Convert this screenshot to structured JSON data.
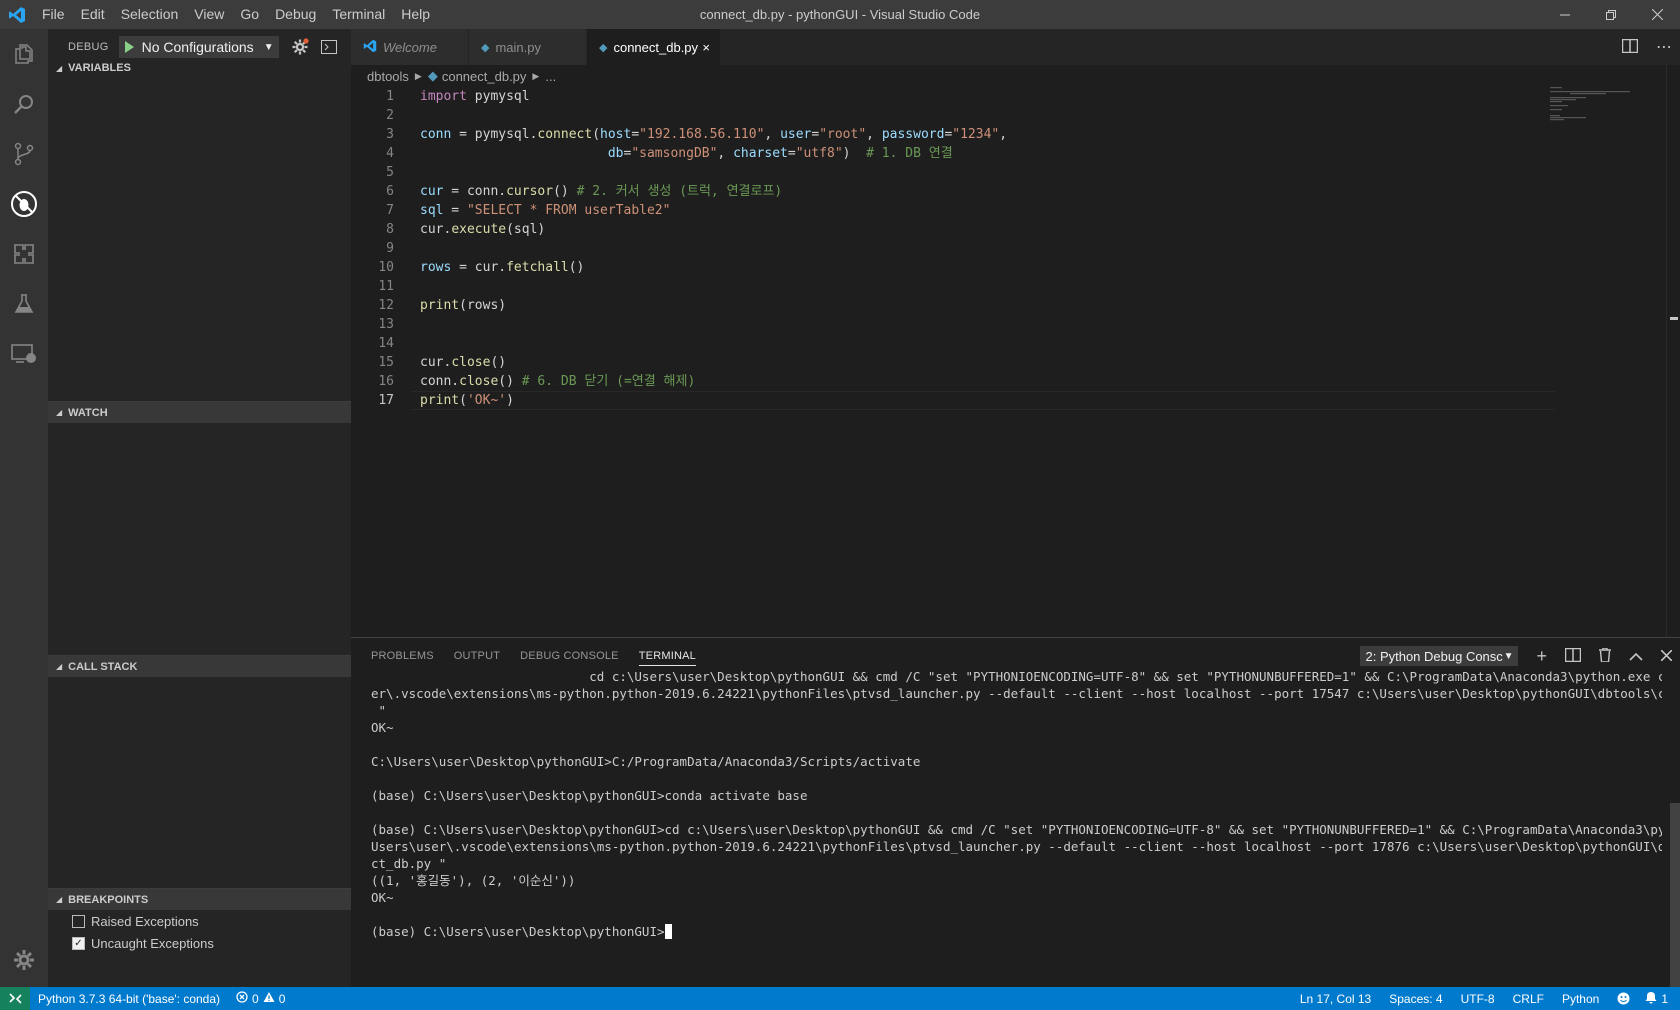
{
  "window": {
    "title": "connect_db.py - pythonGUI - Visual Studio Code",
    "menu": [
      "File",
      "Edit",
      "Selection",
      "View",
      "Go",
      "Debug",
      "Terminal",
      "Help"
    ]
  },
  "colors": {
    "accent": "#007acc",
    "remote": "#16825d",
    "run": "#89d185"
  },
  "activity_icons": [
    "files-icon",
    "search-icon",
    "source-control-icon",
    "debug-icon",
    "extensions-icon",
    "test-flask-icon",
    "remote-explorer-icon"
  ],
  "debug": {
    "label": "DEBUG",
    "configuration": "No Configurations",
    "sections": {
      "variables": "VARIABLES",
      "watch": "WATCH",
      "call_stack": "CALL STACK",
      "breakpoints": "BREAKPOINTS"
    },
    "breakpoints": [
      {
        "label": "Raised Exceptions",
        "checked": false
      },
      {
        "label": "Uncaught Exceptions",
        "checked": true
      }
    ]
  },
  "tabs": [
    {
      "label": "Welcome",
      "icon": "vscode-icon",
      "active": false
    },
    {
      "label": "main.py",
      "icon": "python-icon",
      "active": false
    },
    {
      "label": "connect_db.py",
      "icon": "python-icon",
      "active": true,
      "close": "×"
    }
  ],
  "breadcrumb": {
    "folder": "dbtools",
    "file": "connect_db.py",
    "rest": "..."
  },
  "editor": {
    "current_line": 17,
    "lines": [
      [
        {
          "t": "kw",
          "v": "import"
        },
        {
          "t": "pl",
          "v": " pymysql"
        }
      ],
      [],
      [
        {
          "t": "var",
          "v": "conn"
        },
        {
          "t": "pl",
          "v": " = pymysql."
        },
        {
          "t": "fn",
          "v": "connect"
        },
        {
          "t": "pl",
          "v": "("
        },
        {
          "t": "var",
          "v": "host"
        },
        {
          "t": "pl",
          "v": "="
        },
        {
          "t": "str",
          "v": "\"192.168.56.110\""
        },
        {
          "t": "pl",
          "v": ", "
        },
        {
          "t": "var",
          "v": "user"
        },
        {
          "t": "pl",
          "v": "="
        },
        {
          "t": "str",
          "v": "\"root\""
        },
        {
          "t": "pl",
          "v": ", "
        },
        {
          "t": "var",
          "v": "password"
        },
        {
          "t": "pl",
          "v": "="
        },
        {
          "t": "str",
          "v": "\"1234\""
        },
        {
          "t": "pl",
          "v": ","
        }
      ],
      [
        {
          "t": "pl",
          "v": "                        "
        },
        {
          "t": "var",
          "v": "db"
        },
        {
          "t": "pl",
          "v": "="
        },
        {
          "t": "str",
          "v": "\"samsongDB\""
        },
        {
          "t": "pl",
          "v": ", "
        },
        {
          "t": "var",
          "v": "charset"
        },
        {
          "t": "pl",
          "v": "="
        },
        {
          "t": "str",
          "v": "\"utf8\""
        },
        {
          "t": "pl",
          "v": ")  "
        },
        {
          "t": "cm",
          "v": "# 1. DB 연결"
        }
      ],
      [],
      [
        {
          "t": "var",
          "v": "cur"
        },
        {
          "t": "pl",
          "v": " = conn."
        },
        {
          "t": "fn",
          "v": "cursor"
        },
        {
          "t": "pl",
          "v": "() "
        },
        {
          "t": "cm",
          "v": "# 2. 커서 생성 (트럭, 연결로프)"
        }
      ],
      [
        {
          "t": "var",
          "v": "sql"
        },
        {
          "t": "pl",
          "v": " = "
        },
        {
          "t": "str",
          "v": "\"SELECT * FROM userTable2\""
        }
      ],
      [
        {
          "t": "pl",
          "v": "cur."
        },
        {
          "t": "fn",
          "v": "execute"
        },
        {
          "t": "pl",
          "v": "(sql)"
        }
      ],
      [],
      [
        {
          "t": "var",
          "v": "rows"
        },
        {
          "t": "pl",
          "v": " = cur."
        },
        {
          "t": "fn",
          "v": "fetchall"
        },
        {
          "t": "pl",
          "v": "()"
        }
      ],
      [],
      [
        {
          "t": "fn",
          "v": "print"
        },
        {
          "t": "pl",
          "v": "(rows)"
        }
      ],
      [],
      [],
      [
        {
          "t": "pl",
          "v": "cur."
        },
        {
          "t": "fn",
          "v": "close"
        },
        {
          "t": "pl",
          "v": "()"
        }
      ],
      [
        {
          "t": "pl",
          "v": "conn."
        },
        {
          "t": "fn",
          "v": "close"
        },
        {
          "t": "pl",
          "v": "() "
        },
        {
          "t": "cm",
          "v": "# 6. DB 닫기 (=연결 해제)"
        }
      ],
      [
        {
          "t": "fn",
          "v": "print"
        },
        {
          "t": "pl",
          "v": "("
        },
        {
          "t": "str",
          "v": "'OK~'"
        },
        {
          "t": "pl",
          "v": ")"
        }
      ]
    ]
  },
  "panel": {
    "tabs": [
      "PROBLEMS",
      "OUTPUT",
      "DEBUG CONSOLE",
      "TERMINAL"
    ],
    "active_tab": "TERMINAL",
    "terminal_select": "2: Python Debug Consc",
    "terminal_lines": [
      "                             cd c:\\Users\\user\\Desktop\\pythonGUI && cmd /C \"set \"PYTHONIOENCODING=UTF-8\" && set \"PYTHONUNBUFFERED=1\" && C:\\ProgramData\\Anaconda3\\python.exe c:\\Users\\us",
      "er\\.vscode\\extensions\\ms-python.python-2019.6.24221\\pythonFiles\\ptvsd_launcher.py --default --client --host localhost --port 17547 c:\\Users\\user\\Desktop\\pythonGUI\\dbtools\\connect_db.py",
      " \"",
      "OK~",
      "",
      "C:\\Users\\user\\Desktop\\pythonGUI>C:/ProgramData/Anaconda3/Scripts/activate",
      "",
      "(base) C:\\Users\\user\\Desktop\\pythonGUI>conda activate base",
      "",
      "(base) C:\\Users\\user\\Desktop\\pythonGUI>cd c:\\Users\\user\\Desktop\\pythonGUI && cmd /C \"set \"PYTHONIOENCODING=UTF-8\" && set \"PYTHONUNBUFFERED=1\" && C:\\ProgramData\\Anaconda3\\python.exe c:\\",
      "Users\\user\\.vscode\\extensions\\ms-python.python-2019.6.24221\\pythonFiles\\ptvsd_launcher.py --default --client --host localhost --port 17876 c:\\Users\\user\\Desktop\\pythonGUI\\dbtools\\conne",
      "ct_db.py \"",
      "((1, '홍길동'), (2, '이순신'))",
      "OK~",
      ""
    ],
    "prompt": "(base) C:\\Users\\user\\Desktop\\pythonGUI>"
  },
  "status": {
    "python": "Python 3.7.3 64-bit ('base': conda)",
    "errors": "0",
    "warnings": "0",
    "position": "Ln 17, Col 13",
    "spaces": "Spaces: 4",
    "encoding": "UTF-8",
    "eol": "CRLF",
    "language": "Python",
    "notifications": "1"
  }
}
